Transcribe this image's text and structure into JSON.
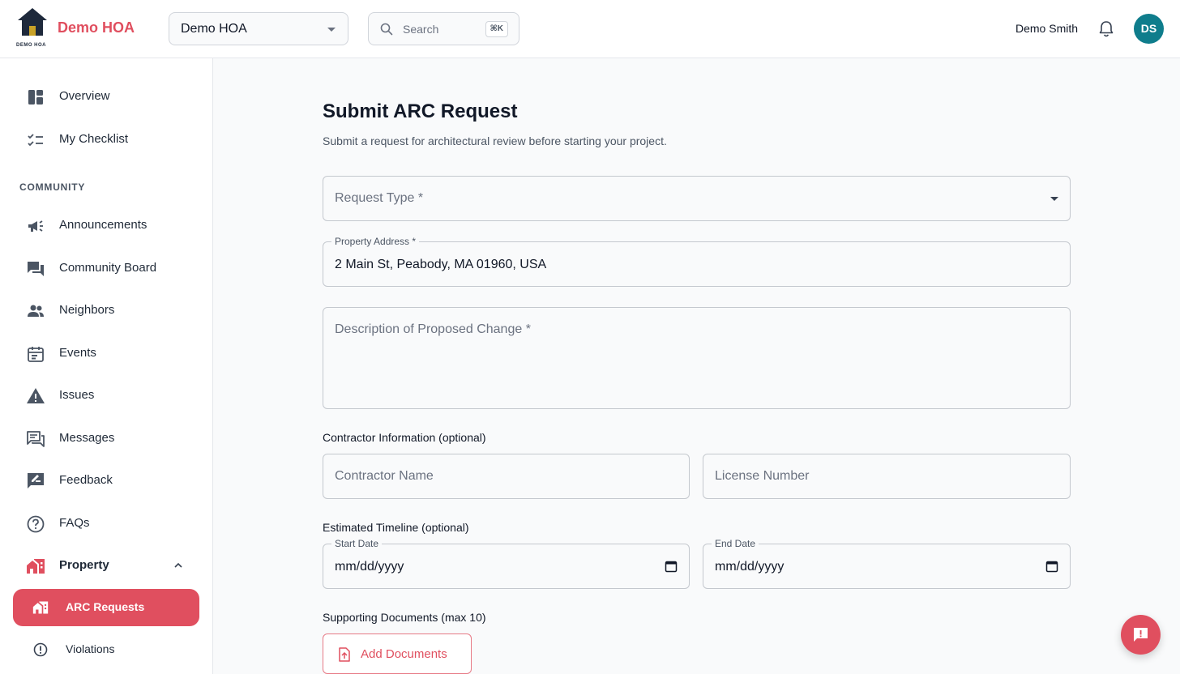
{
  "header": {
    "logo_text": "DEMO HOA",
    "brand": "Demo HOA",
    "hoa_select_value": "Demo HOA",
    "search_placeholder": "Search",
    "search_shortcut": "⌘K",
    "user_name": "Demo Smith",
    "avatar_initials": "DS"
  },
  "sidebar": {
    "overview": "Overview",
    "checklist": "My Checklist",
    "section_community": "COMMUNITY",
    "announcements": "Announcements",
    "community_board": "Community Board",
    "neighbors": "Neighbors",
    "events": "Events",
    "issues": "Issues",
    "messages": "Messages",
    "feedback": "Feedback",
    "faqs": "FAQs",
    "property": "Property",
    "arc_requests": "ARC Requests",
    "violations": "Violations"
  },
  "form": {
    "title": "Submit ARC Request",
    "subtitle": "Submit a request for architectural review before starting your project.",
    "request_type_placeholder": "Request Type *",
    "property_address_label": "Property Address *",
    "property_address_value": "2 Main St, Peabody, MA 01960, USA",
    "description_placeholder": "Description of Proposed Change *",
    "contractor_section": "Contractor Information (optional)",
    "contractor_name_placeholder": "Contractor Name",
    "license_number_placeholder": "License Number",
    "timeline_section": "Estimated Timeline (optional)",
    "start_date_label": "Start Date",
    "start_date_value": "mm/dd/yyyy",
    "end_date_label": "End Date",
    "end_date_value": "mm/dd/yyyy",
    "documents_section": "Supporting Documents (max 10)",
    "add_documents_label": "Add Documents"
  },
  "colors": {
    "accent": "#e04f5f",
    "avatar": "#0f7d8c"
  }
}
